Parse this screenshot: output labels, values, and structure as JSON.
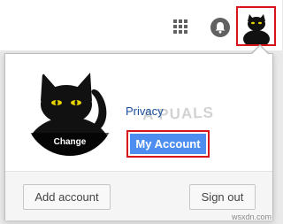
{
  "topbar": {
    "apps_icon": "apps-grid-icon",
    "notifications_icon": "notifications-bell-icon",
    "avatar_icon": "black-cat-avatar"
  },
  "account_popup": {
    "photo_change_label": "Change",
    "privacy_link": "Privacy",
    "my_account_button": "My Account",
    "add_account_button": "Add account",
    "sign_out_button": "Sign out"
  },
  "watermark": "A PUALS",
  "site_mark": "wsxdn.com",
  "colors": {
    "highlight_border": "#d7141a",
    "my_account_bg": "#4d8ef0",
    "link": "#1a4fa0"
  }
}
